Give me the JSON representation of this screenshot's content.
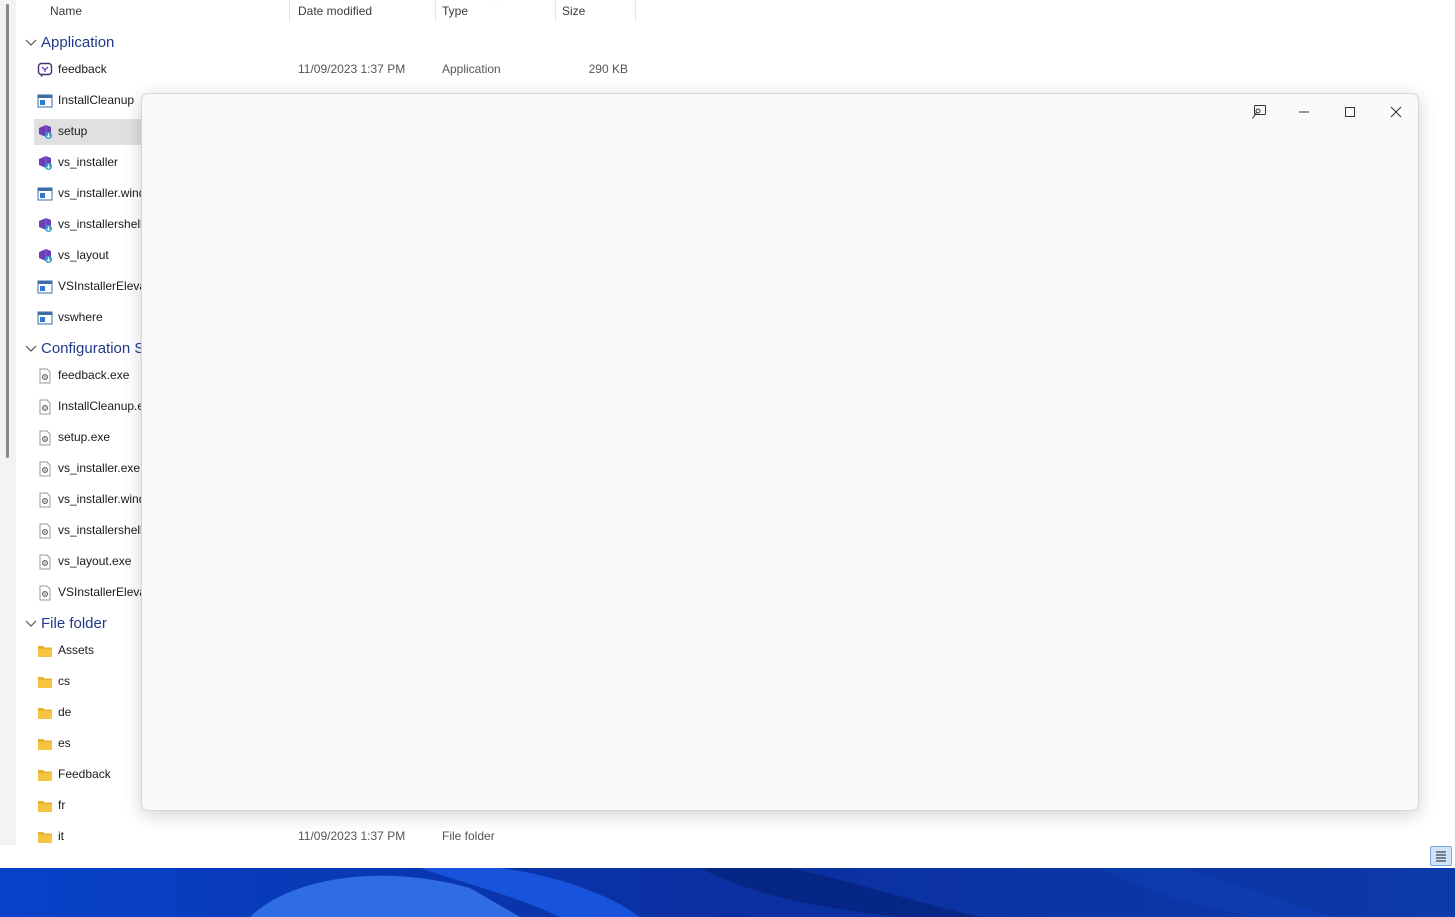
{
  "columns": {
    "name": "Name",
    "date_modified": "Date modified",
    "type": "Type",
    "size": "Size"
  },
  "groups": {
    "application": "Application",
    "configuration": "Configuration S",
    "file_folder": "File folder"
  },
  "application_rows": [
    {
      "name": "feedback",
      "date": "11/09/2023 1:37 PM",
      "type": "Application",
      "size": "290 KB",
      "icon": "feedback-app-icon"
    },
    {
      "name": "InstallCleanup",
      "icon": "window-app-icon"
    },
    {
      "name": "setup",
      "icon": "vs-installer-icon",
      "selected": true
    },
    {
      "name": "vs_installer",
      "icon": "vs-installer-icon"
    },
    {
      "name": "vs_installer.wind",
      "icon": "window-app-icon"
    },
    {
      "name": "vs_installershell",
      "icon": "vs-installer-icon"
    },
    {
      "name": "vs_layout",
      "icon": "vs-installer-icon"
    },
    {
      "name": "VSInstallerElevat",
      "icon": "window-app-icon"
    },
    {
      "name": "vswhere",
      "icon": "window-app-icon"
    }
  ],
  "config_rows": [
    {
      "name": "feedback.exe"
    },
    {
      "name": "InstallCleanup.e"
    },
    {
      "name": "setup.exe"
    },
    {
      "name": "vs_installer.exe"
    },
    {
      "name": "vs_installer.wind"
    },
    {
      "name": "vs_installershell."
    },
    {
      "name": "vs_layout.exe"
    },
    {
      "name": "VSInstallerElevat"
    }
  ],
  "folder_rows": [
    {
      "name": "Assets"
    },
    {
      "name": "cs"
    },
    {
      "name": "de"
    },
    {
      "name": "es"
    },
    {
      "name": "Feedback"
    },
    {
      "name": "fr"
    },
    {
      "name": "it",
      "date": "11/09/2023 1:37 PM",
      "type": "File folder"
    }
  ],
  "icons": {
    "sort": "chevron-up-icon",
    "group_toggle": "chevron-down-icon",
    "config_file": "config-file-icon",
    "folder": "folder-icon",
    "pin": "pin-icon",
    "minimize": "minimize-icon",
    "maximize": "maximize-icon",
    "close": "close-icon",
    "details_view": "details-view-icon"
  },
  "colors": {
    "group_header": "#1f3a8a",
    "selection": "#e0e0e0",
    "folder": "#f5c542",
    "vs_purple": "#6a3fb8",
    "overlay_bg": "#fafafa",
    "wallpaper": "#0a3db8"
  }
}
